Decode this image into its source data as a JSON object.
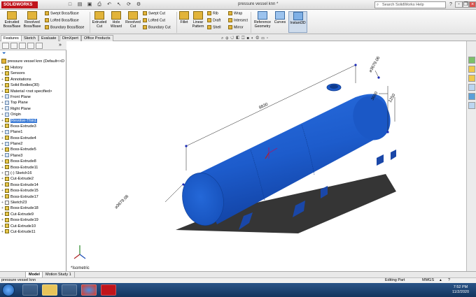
{
  "app": {
    "brand": "SOLIDWORKS",
    "title": "pressure vessel knn *"
  },
  "search": {
    "placeholder": "Search SolidWorks Help"
  },
  "ribbon": {
    "extruded_boss": "Extruded Boss/Base",
    "revolved_boss": "Revolved Boss/Base",
    "swept_boss": "Swept Boss/Base",
    "lofted_boss": "Lofted Boss/Base",
    "boundary_boss": "Boundary Boss/Base",
    "extruded_cut": "Extruded Cut",
    "hole_wizard": "Hole Wizard",
    "revolved_cut": "Revolved Cut",
    "swept_cut": "Swept Cut",
    "lofted_cut": "Lofted Cut",
    "boundary_cut": "Boundary Cut",
    "fillet": "Fillet",
    "linear_pattern": "Linear Pattern",
    "rib": "Rib",
    "draft": "Draft",
    "shell": "Shell",
    "wrap": "Wrap",
    "intersect": "Intersect",
    "mirror": "Mirror",
    "reference_geometry": "Reference Geometry",
    "curves": "Curves",
    "instant3d": "Instant3D"
  },
  "tabs": [
    "Features",
    "Sketch",
    "Evaluate",
    "DimXpert",
    "Office Products"
  ],
  "tree": {
    "root": "pressure vessel knn  (Default<<D",
    "items": [
      {
        "label": "History",
        "icon": "folder-icon"
      },
      {
        "label": "Sensors",
        "icon": "sensor-icon"
      },
      {
        "label": "Annotations",
        "icon": "annotation-icon"
      },
      {
        "label": "Solid Bodies(30)",
        "icon": "solid-bodies-icon"
      },
      {
        "label": "Material <not specified>",
        "icon": "material-icon"
      },
      {
        "label": "Front Plane",
        "icon": "plane-icon"
      },
      {
        "label": "Top Plane",
        "icon": "plane-icon"
      },
      {
        "label": "Right Plane",
        "icon": "plane-icon"
      },
      {
        "label": "Origin",
        "icon": "origin-icon"
      },
      {
        "label": "Revolve-Thin1",
        "icon": "feature-icon",
        "selected": true
      },
      {
        "label": "Boss-Extrude3",
        "icon": "feature-icon"
      },
      {
        "label": "Plane1",
        "icon": "plane-icon"
      },
      {
        "label": "Boss-Extrude4",
        "icon": "feature-icon"
      },
      {
        "label": "Plane2",
        "icon": "plane-icon"
      },
      {
        "label": "Boss-Extrude5",
        "icon": "feature-icon"
      },
      {
        "label": "Plane3",
        "icon": "plane-icon"
      },
      {
        "label": "Boss-Extrude8",
        "icon": "feature-icon"
      },
      {
        "label": "Boss-Extrude11",
        "icon": "feature-icon"
      },
      {
        "label": "(-) Sketch16",
        "icon": "sketch-icon"
      },
      {
        "label": "Cut-Extrude2",
        "icon": "feature-icon"
      },
      {
        "label": "Boss-Extrude14",
        "icon": "feature-icon"
      },
      {
        "label": "Boss-Extrude15",
        "icon": "feature-icon"
      },
      {
        "label": "Boss-Extrude17",
        "icon": "feature-icon"
      },
      {
        "label": "Sketch23",
        "icon": "sketch-icon"
      },
      {
        "label": "Boss-Extrude18",
        "icon": "feature-icon"
      },
      {
        "label": "Cut-Extrude9",
        "icon": "feature-icon"
      },
      {
        "label": "Boss-Extrude19",
        "icon": "feature-icon"
      },
      {
        "label": "Cut-Extrude10",
        "icon": "feature-icon"
      },
      {
        "label": "Cut-Extrude11",
        "icon": "feature-icon"
      }
    ]
  },
  "viewport": {
    "dims": {
      "length": "8830",
      "dia_top": "⌀3679.06",
      "dia_left": "⌀3679.06",
      "height1": "3600",
      "height2": "1250"
    },
    "view_label": "*Isometric",
    "colors": {
      "vessel": "#1e63d8",
      "vessel_dark": "#134aa8",
      "dimension": "#1a1a1a",
      "shadow": "#222222"
    }
  },
  "bottom_tabs": [
    "Model",
    "Motion Study 1"
  ],
  "status": {
    "left": "pressure vessel knn",
    "mode": "Editing Part",
    "units": "MMGS"
  },
  "clock": {
    "time": "7:52 PM",
    "date": "11/2/2020"
  }
}
